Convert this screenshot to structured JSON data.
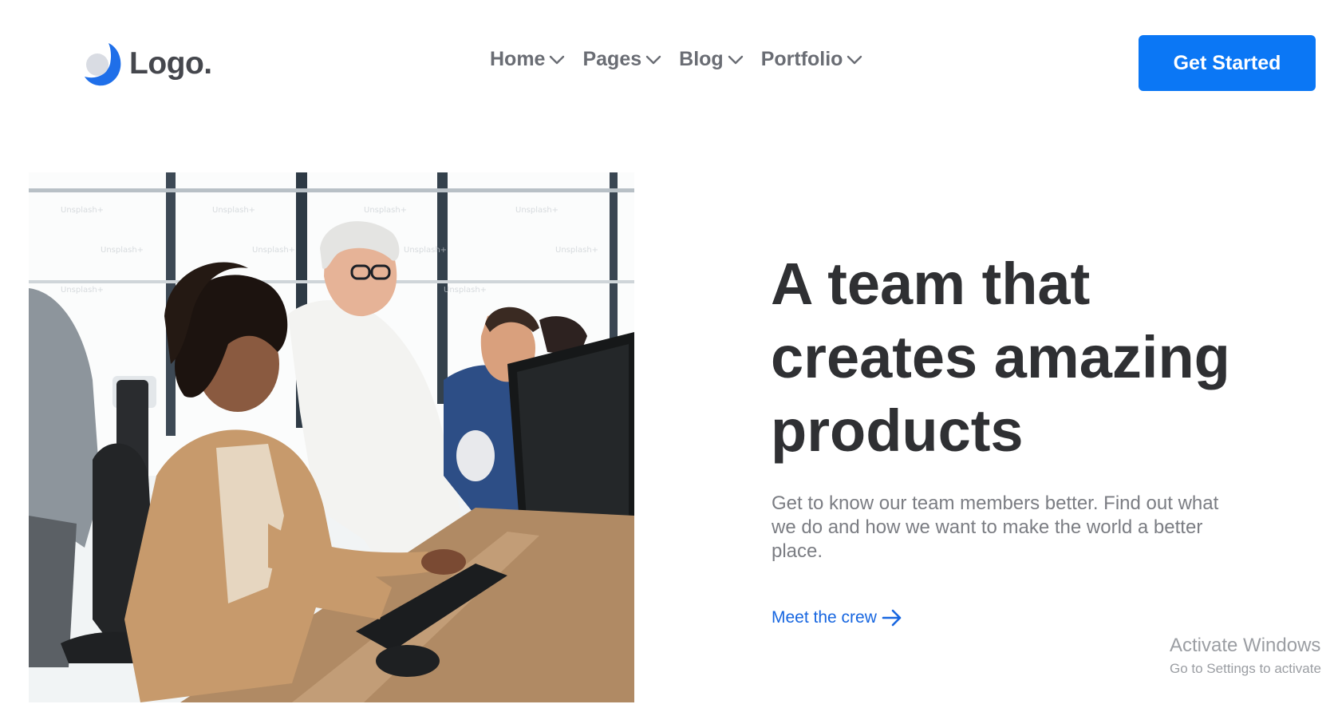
{
  "header": {
    "logo_text": "Logo.",
    "nav": [
      {
        "label": "Home"
      },
      {
        "label": "Pages"
      },
      {
        "label": "Blog"
      },
      {
        "label": "Portfolio"
      }
    ],
    "cta_label": "Get Started"
  },
  "hero": {
    "headline": "A team that creates amazing products",
    "description": "Get to know our team members better. Find out what we do and how we want to make the world a better place.",
    "link_label": "Meet the crew"
  },
  "os_watermark": {
    "title": "Activate Windows",
    "subtitle": "Go to Settings to activate"
  },
  "colors": {
    "accent": "#0b77f5",
    "link": "#1766e0",
    "heading": "#2f3033",
    "body_text": "#7b7d83",
    "nav_text": "#6a6d74"
  },
  "icons": {
    "nav_dropdown": "chevron-down-icon",
    "link_arrow": "arrow-right-icon",
    "logo": "crescent-logo-icon"
  }
}
